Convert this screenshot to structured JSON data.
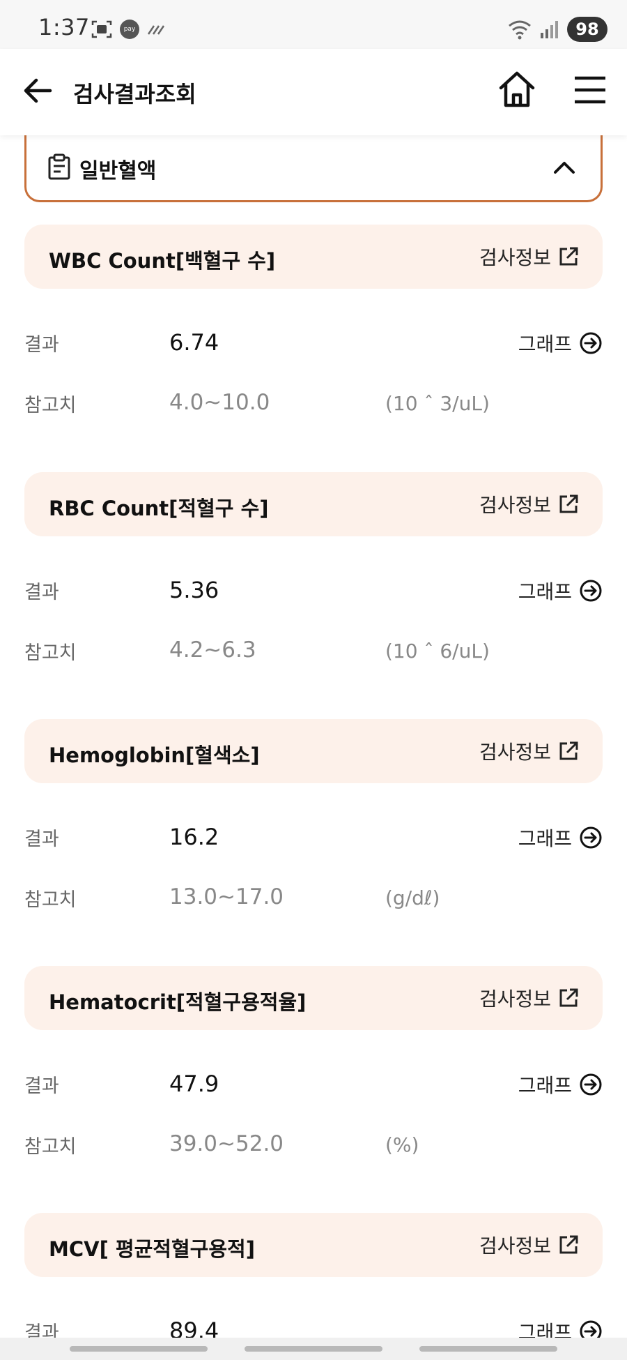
{
  "status_bar": {
    "time": "1:37",
    "pay_label": "pay",
    "battery": "98"
  },
  "header": {
    "title": "검사결과조회"
  },
  "section": {
    "title": "일반혈액"
  },
  "labels": {
    "result": "결과",
    "reference": "참고치",
    "test_info": "검사정보",
    "graph": "그래프"
  },
  "tests": [
    {
      "name": "WBC Count[백혈구 수]",
      "result": "6.74",
      "reference": "4.0~10.0",
      "unit": "(10 ˆ 3/uL)"
    },
    {
      "name": "RBC Count[적혈구 수]",
      "result": "5.36",
      "reference": "4.2~6.3",
      "unit": "(10 ˆ 6/uL)"
    },
    {
      "name": "Hemoglobin[혈색소]",
      "result": "16.2",
      "reference": "13.0~17.0",
      "unit": "(g/dℓ)"
    },
    {
      "name": "Hematocrit[적혈구용적율]",
      "result": "47.9",
      "reference": "39.0~52.0",
      "unit": "(%)"
    },
    {
      "name": "MCV[ 평균적혈구용적]",
      "result": "89.4",
      "reference": "",
      "unit": ""
    }
  ],
  "icons": {
    "back": "arrow-left-icon",
    "home": "home-icon",
    "menu": "menu-icon",
    "section": "clipboard-icon",
    "collapse": "chevron-up-icon",
    "external": "external-link-icon",
    "graph": "arrow-circle-right-icon"
  },
  "colors": {
    "accent_border": "#c8703a",
    "header_bg": "#fdf1ea"
  }
}
